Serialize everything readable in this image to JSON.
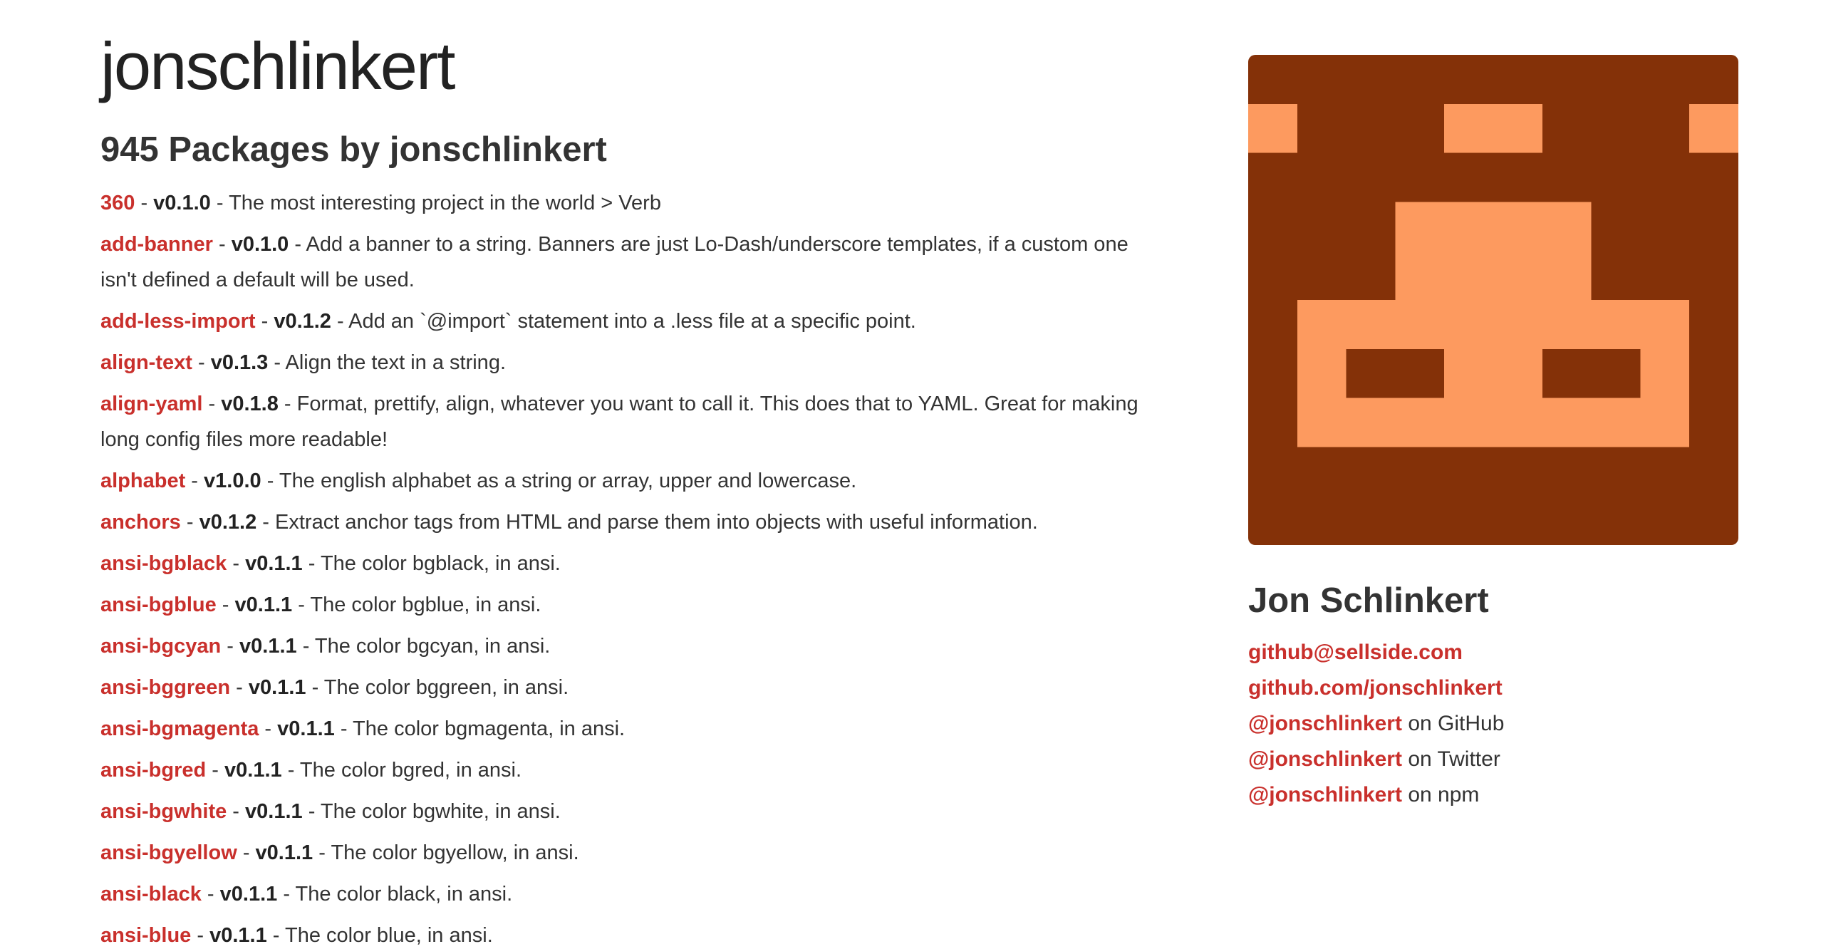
{
  "header": {
    "username": "jonschlinkert"
  },
  "packages": {
    "heading": "945 Packages by jonschlinkert",
    "items": [
      {
        "name": "360",
        "version": "v0.1.0",
        "description": "The most interesting project in the world > Verb"
      },
      {
        "name": "add-banner",
        "version": "v0.1.0",
        "description": "Add a banner to a string. Banners are just Lo-Dash/underscore templates, if a custom one isn't defined a default will be used."
      },
      {
        "name": "add-less-import",
        "version": "v0.1.2",
        "description": "Add an `@import` statement into a .less file at a specific point."
      },
      {
        "name": "align-text",
        "version": "v0.1.3",
        "description": "Align the text in a string."
      },
      {
        "name": "align-yaml",
        "version": "v0.1.8",
        "description": "Format, prettify, align, whatever you want to call it. This does that to YAML. Great for making long config files more readable!"
      },
      {
        "name": "alphabet",
        "version": "v1.0.0",
        "description": "The english alphabet as a string or array, upper and lowercase."
      },
      {
        "name": "anchors",
        "version": "v0.1.2",
        "description": "Extract anchor tags from HTML and parse them into objects with useful information."
      },
      {
        "name": "ansi-bgblack",
        "version": "v0.1.1",
        "description": "The color bgblack, in ansi."
      },
      {
        "name": "ansi-bgblue",
        "version": "v0.1.1",
        "description": "The color bgblue, in ansi."
      },
      {
        "name": "ansi-bgcyan",
        "version": "v0.1.1",
        "description": "The color bgcyan, in ansi."
      },
      {
        "name": "ansi-bggreen",
        "version": "v0.1.1",
        "description": "The color bggreen, in ansi."
      },
      {
        "name": "ansi-bgmagenta",
        "version": "v0.1.1",
        "description": "The color bgmagenta, in ansi."
      },
      {
        "name": "ansi-bgred",
        "version": "v0.1.1",
        "description": "The color bgred, in ansi."
      },
      {
        "name": "ansi-bgwhite",
        "version": "v0.1.1",
        "description": "The color bgwhite, in ansi."
      },
      {
        "name": "ansi-bgyellow",
        "version": "v0.1.1",
        "description": "The color bgyellow, in ansi."
      },
      {
        "name": "ansi-black",
        "version": "v0.1.1",
        "description": "The color black, in ansi."
      },
      {
        "name": "ansi-blue",
        "version": "v0.1.1",
        "description": "The color blue, in ansi."
      }
    ]
  },
  "profile": {
    "name": "Jon Schlinkert",
    "email": "github@sellside.com",
    "github_url": "github.com/jonschlinkert",
    "links": [
      {
        "handle": "@jonschlinkert",
        "suffix": "on GitHub"
      },
      {
        "handle": "@jonschlinkert",
        "suffix": "on Twitter"
      },
      {
        "handle": "@jonschlinkert",
        "suffix": "on npm"
      }
    ]
  },
  "colors": {
    "link": "#c9302c",
    "avatar_dark": "#843108",
    "avatar_light": "#fd9a5f"
  }
}
